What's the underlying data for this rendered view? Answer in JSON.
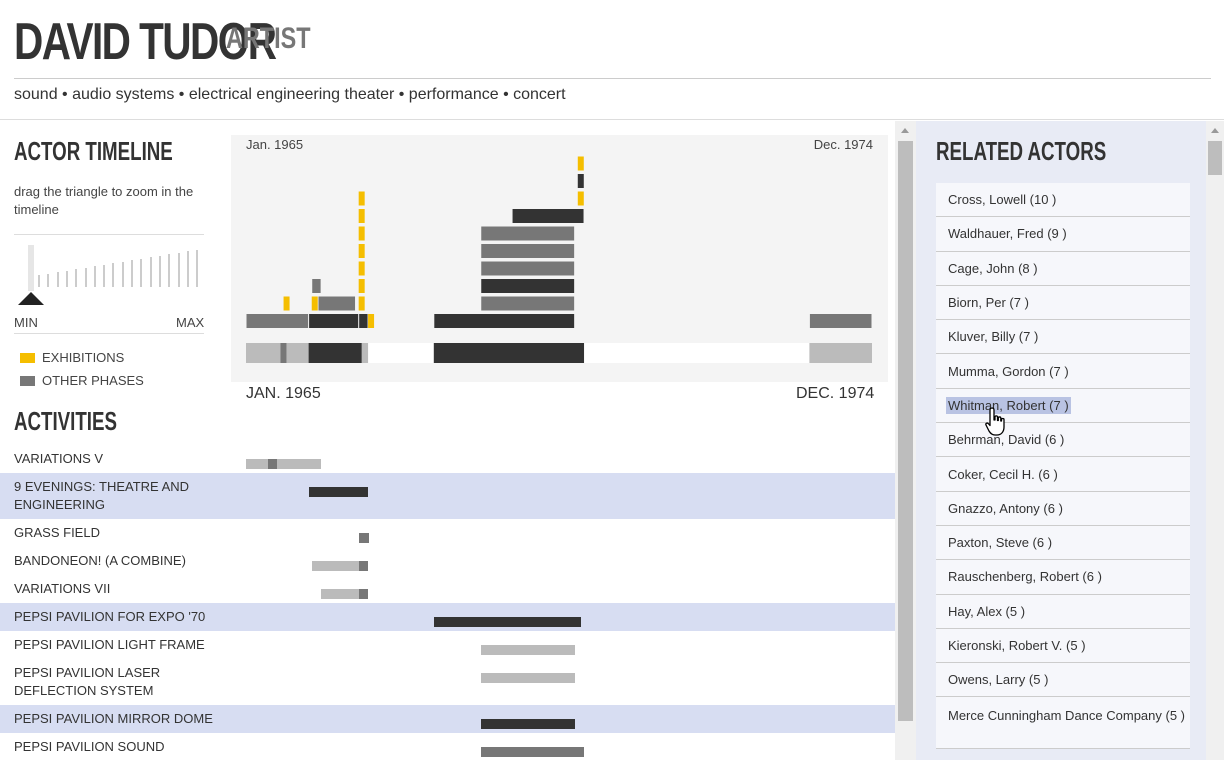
{
  "header": {
    "name": "DAVID TUDOR",
    "role": "ARTIST",
    "keywords": "sound • audio systems • electrical engineering theater • performance • concert"
  },
  "timeline": {
    "heading": "ACTOR TIMELINE",
    "zoom_hint": "drag the triangle to zoom in the timeline",
    "zoom_min": "MIN",
    "zoom_max": "MAX",
    "range_start_label": "Jan. 1965",
    "range_end_label": "Dec. 1974",
    "axis_start": "JAN. 1965",
    "axis_end": "DEC. 1974"
  },
  "legend": {
    "exhibitions": "EXHIBITIONS",
    "other_phases": "OTHER PHASES"
  },
  "colors": {
    "exhibition": "#f5be00",
    "phase_dark": "#333333",
    "phase_mid": "#777777",
    "phase_light": "#bbbbbb",
    "highlight": "#d7ddf2",
    "panel": "#e8ebf5"
  },
  "activities": {
    "heading": "ACTIVITIES",
    "items": [
      {
        "label": "VARIATIONS V",
        "highlighted": false,
        "bars": [
          {
            "start": 1965.0,
            "end": 1966.2,
            "tone": "light"
          },
          {
            "start": 1965.35,
            "end": 1965.5,
            "tone": "mid"
          }
        ]
      },
      {
        "label": "9 EVENINGS: THEATRE AND ENGINEERING",
        "highlighted": true,
        "bars": [
          {
            "start": 1966.0,
            "end": 1966.95,
            "tone": "dark"
          }
        ]
      },
      {
        "label": "GRASS FIELD",
        "highlighted": false,
        "bars": [
          {
            "start": 1966.8,
            "end": 1966.97,
            "tone": "mid"
          }
        ]
      },
      {
        "label": "BANDONEON! (A COMBINE)",
        "highlighted": false,
        "bars": [
          {
            "start": 1966.05,
            "end": 1966.95,
            "tone": "light"
          },
          {
            "start": 1966.8,
            "end": 1966.95,
            "tone": "mid"
          }
        ]
      },
      {
        "label": "VARIATIONS VII",
        "highlighted": false,
        "bars": [
          {
            "start": 1966.2,
            "end": 1966.95,
            "tone": "light"
          },
          {
            "start": 1966.8,
            "end": 1966.95,
            "tone": "mid"
          }
        ]
      },
      {
        "label": "PEPSI PAVILION FOR EXPO '70",
        "highlighted": true,
        "bars": [
          {
            "start": 1968.0,
            "end": 1970.35,
            "tone": "dark"
          }
        ]
      },
      {
        "label": "PEPSI PAVILION LIGHT FRAME",
        "highlighted": false,
        "bars": [
          {
            "start": 1968.75,
            "end": 1970.25,
            "tone": "light"
          }
        ]
      },
      {
        "label": "PEPSI PAVILION LASER DEFLECTION SYSTEM",
        "highlighted": false,
        "bars": [
          {
            "start": 1968.75,
            "end": 1970.25,
            "tone": "light"
          }
        ]
      },
      {
        "label": "PEPSI PAVILION MIRROR DOME",
        "highlighted": true,
        "bars": [
          {
            "start": 1968.75,
            "end": 1970.25,
            "tone": "dark"
          }
        ]
      },
      {
        "label": "PEPSI PAVILION SOUND SYSTEM",
        "highlighted": false,
        "bars": [
          {
            "start": 1968.75,
            "end": 1970.4,
            "tone": "mid"
          }
        ]
      }
    ]
  },
  "related": {
    "heading": "RELATED ACTORS",
    "actors": [
      {
        "label": "Cross, Lowell (10 )",
        "highlighted": false
      },
      {
        "label": "Waldhauer, Fred (9 )",
        "highlighted": false
      },
      {
        "label": "Cage, John (8 )",
        "highlighted": false
      },
      {
        "label": "Biorn, Per (7 )",
        "highlighted": false
      },
      {
        "label": "Kluver, Billy (7 )",
        "highlighted": false
      },
      {
        "label": "Mumma, Gordon (7 )",
        "highlighted": false
      },
      {
        "label": "Whitman, Robert (7 )",
        "highlighted": true
      },
      {
        "label": "Behrman, David (6 )",
        "highlighted": false
      },
      {
        "label": "Coker, Cecil H. (6 )",
        "highlighted": false
      },
      {
        "label": "Gnazzo, Antony (6 )",
        "highlighted": false
      },
      {
        "label": "Paxton, Steve (6 )",
        "highlighted": false
      },
      {
        "label": "Rauschenberg, Robert (6 )",
        "highlighted": false
      },
      {
        "label": "Hay, Alex (5 )",
        "highlighted": false
      },
      {
        "label": "Kieronski, Robert V. (5 )",
        "highlighted": false
      },
      {
        "label": "Owens, Larry (5 )",
        "highlighted": false
      },
      {
        "label": "Merce Cunningham Dance Company (5 )",
        "highlighted": false
      }
    ]
  },
  "chart_data": {
    "type": "bar",
    "x_range": [
      1965.0,
      1975.0
    ],
    "stacked_phases": [
      {
        "start": 1965.0,
        "end": 1966.0,
        "level": 0,
        "tone": "mid"
      },
      {
        "start": 1966.0,
        "end": 1966.8,
        "level": 0,
        "tone": "dark"
      },
      {
        "start": 1966.8,
        "end": 1966.95,
        "level": 0,
        "tone": "dark"
      },
      {
        "start": 1966.15,
        "end": 1966.75,
        "level": 1,
        "tone": "mid"
      },
      {
        "start": 1966.05,
        "end": 1966.2,
        "level": 2,
        "tone": "mid"
      },
      {
        "start": 1968.0,
        "end": 1970.25,
        "level": 0,
        "tone": "dark"
      },
      {
        "start": 1968.75,
        "end": 1970.25,
        "level": 1,
        "tone": "mid"
      },
      {
        "start": 1968.75,
        "end": 1970.25,
        "level": 2,
        "tone": "dark"
      },
      {
        "start": 1968.75,
        "end": 1970.25,
        "level": 3,
        "tone": "mid"
      },
      {
        "start": 1968.75,
        "end": 1970.25,
        "level": 4,
        "tone": "mid"
      },
      {
        "start": 1968.75,
        "end": 1970.25,
        "level": 5,
        "tone": "mid"
      },
      {
        "start": 1969.25,
        "end": 1970.4,
        "level": 6,
        "tone": "dark"
      },
      {
        "start": 1974.0,
        "end": 1975.0,
        "level": 0,
        "tone": "mid"
      }
    ],
    "exhibitions": [
      {
        "x": 1965.6,
        "level": 1
      },
      {
        "x": 1966.05,
        "level": 1
      },
      {
        "x": 1966.8,
        "level": 1
      },
      {
        "x": 1966.8,
        "level": 2
      },
      {
        "x": 1966.8,
        "level": 3
      },
      {
        "x": 1966.8,
        "level": 4
      },
      {
        "x": 1966.8,
        "level": 5
      },
      {
        "x": 1966.8,
        "level": 6
      },
      {
        "x": 1966.8,
        "level": 7
      },
      {
        "x": 1966.95,
        "level": 0
      },
      {
        "x": 1970.3,
        "level": 7
      },
      {
        "x": 1970.3,
        "level": 9
      }
    ],
    "extra_dark": [
      {
        "x": 1970.3,
        "level": 8
      }
    ],
    "overview": [
      {
        "start": 1965.0,
        "end": 1965.55,
        "tone": "light"
      },
      {
        "start": 1965.55,
        "end": 1965.65,
        "tone": "mid"
      },
      {
        "start": 1965.65,
        "end": 1966.0,
        "tone": "light"
      },
      {
        "start": 1966.0,
        "end": 1966.85,
        "tone": "dark"
      },
      {
        "start": 1966.85,
        "end": 1966.95,
        "tone": "light"
      },
      {
        "start": 1968.0,
        "end": 1970.4,
        "tone": "dark"
      },
      {
        "start": 1974.0,
        "end": 1975.0,
        "tone": "light"
      }
    ]
  }
}
